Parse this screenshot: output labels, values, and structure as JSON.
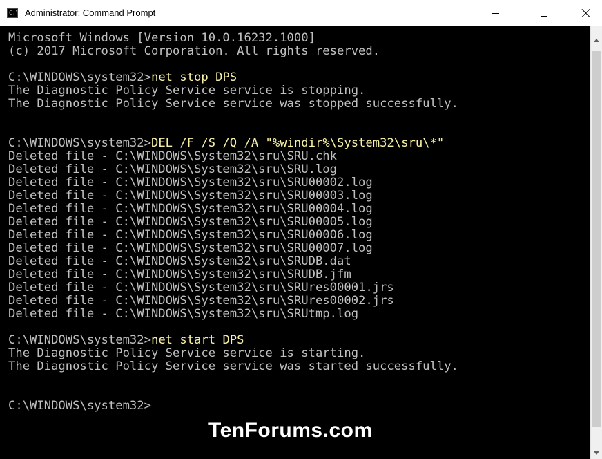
{
  "window": {
    "title": "Administrator: Command Prompt"
  },
  "console": {
    "lines": [
      {
        "text": "Microsoft Windows [Version 10.0.16232.1000]"
      },
      {
        "text": "(c) 2017 Microsoft Corporation. All rights reserved."
      },
      {
        "text": ""
      },
      {
        "prompt": "C:\\WINDOWS\\system32>",
        "command": "net stop DPS"
      },
      {
        "text": "The Diagnostic Policy Service service is stopping."
      },
      {
        "text": "The Diagnostic Policy Service service was stopped successfully."
      },
      {
        "text": ""
      },
      {
        "text": ""
      },
      {
        "prompt": "C:\\WINDOWS\\system32>",
        "command": "DEL /F /S /Q /A \"%windir%\\System32\\sru\\*\""
      },
      {
        "text": "Deleted file - C:\\WINDOWS\\System32\\sru\\SRU.chk"
      },
      {
        "text": "Deleted file - C:\\WINDOWS\\System32\\sru\\SRU.log"
      },
      {
        "text": "Deleted file - C:\\WINDOWS\\System32\\sru\\SRU00002.log"
      },
      {
        "text": "Deleted file - C:\\WINDOWS\\System32\\sru\\SRU00003.log"
      },
      {
        "text": "Deleted file - C:\\WINDOWS\\System32\\sru\\SRU00004.log"
      },
      {
        "text": "Deleted file - C:\\WINDOWS\\System32\\sru\\SRU00005.log"
      },
      {
        "text": "Deleted file - C:\\WINDOWS\\System32\\sru\\SRU00006.log"
      },
      {
        "text": "Deleted file - C:\\WINDOWS\\System32\\sru\\SRU00007.log"
      },
      {
        "text": "Deleted file - C:\\WINDOWS\\System32\\sru\\SRUDB.dat"
      },
      {
        "text": "Deleted file - C:\\WINDOWS\\System32\\sru\\SRUDB.jfm"
      },
      {
        "text": "Deleted file - C:\\WINDOWS\\System32\\sru\\SRUres00001.jrs"
      },
      {
        "text": "Deleted file - C:\\WINDOWS\\System32\\sru\\SRUres00002.jrs"
      },
      {
        "text": "Deleted file - C:\\WINDOWS\\System32\\sru\\SRUtmp.log"
      },
      {
        "text": ""
      },
      {
        "prompt": "C:\\WINDOWS\\system32>",
        "command": "net start DPS"
      },
      {
        "text": "The Diagnostic Policy Service service is starting."
      },
      {
        "text": "The Diagnostic Policy Service service was started successfully."
      },
      {
        "text": ""
      },
      {
        "text": ""
      },
      {
        "prompt": "C:\\WINDOWS\\system32>",
        "command": ""
      }
    ]
  },
  "watermark": {
    "text": "TenForums.com"
  },
  "colors": {
    "background": "#000000",
    "output": "#c0c0c0",
    "command": "#f9f1a5",
    "titlebar": "#ffffff"
  },
  "icons": {
    "app": "console-icon",
    "minimize": "minimize-icon",
    "maximize": "maximize-icon",
    "close": "close-icon"
  }
}
